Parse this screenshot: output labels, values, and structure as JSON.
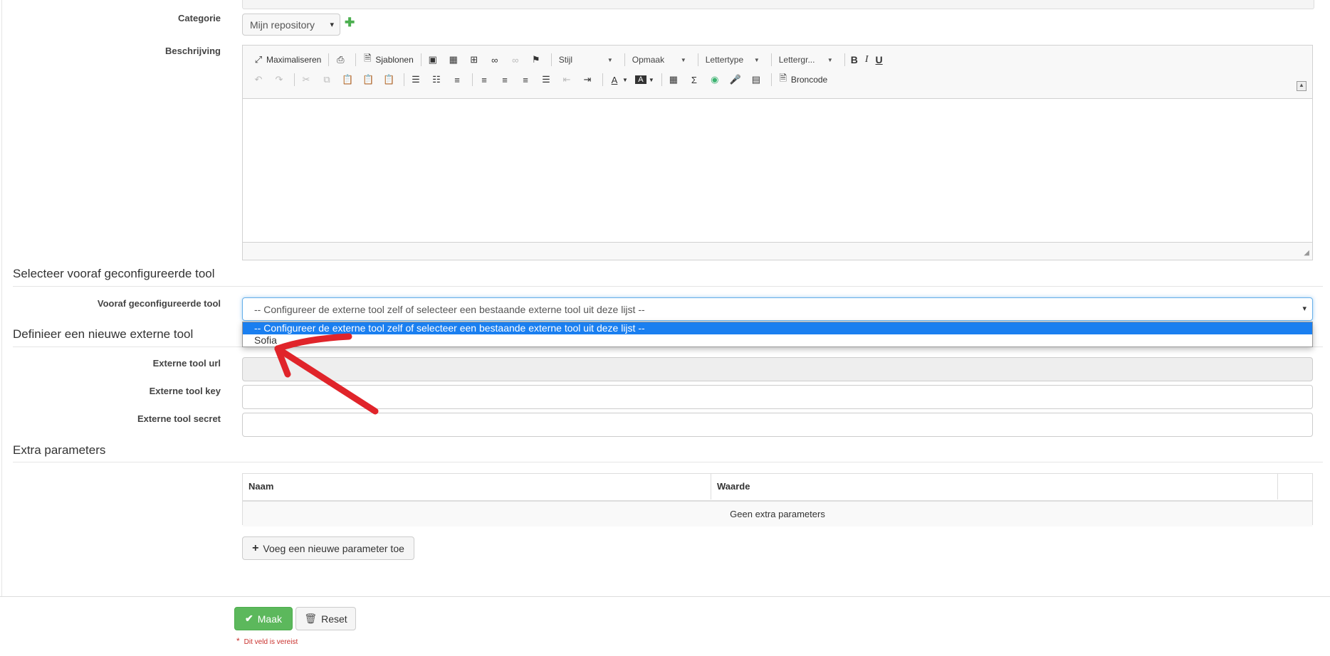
{
  "form": {
    "categorie_label": "Categorie",
    "categorie_value": "Mijn repository",
    "beschrijving_label": "Beschrijving"
  },
  "editor": {
    "row1": {
      "maximize": "Maximaliseren",
      "templates": "Sjablonen",
      "style": "Stijl",
      "format": "Opmaak",
      "font": "Lettertype",
      "size": "Lettergr...",
      "bold": "B",
      "italic": "I",
      "underline": "U"
    },
    "row2": {
      "source": "Broncode"
    }
  },
  "section_preconfigured": {
    "title": "Selecteer vooraf geconfigureerde tool",
    "label": "Vooraf geconfigureerde tool",
    "selected": "-- Configureer de externe tool zelf of selecteer een bestaande externe tool uit deze lijst --",
    "options": [
      "-- Configureer de externe tool zelf of selecteer een bestaande externe tool uit deze lijst --",
      "Sofia"
    ]
  },
  "section_new": {
    "title": "Definieer een nieuwe externe tool",
    "url_label": "Externe tool url",
    "key_label": "Externe tool key",
    "secret_label": "Externe tool secret"
  },
  "section_extra": {
    "title": "Extra parameters",
    "col_name": "Naam",
    "col_value": "Waarde",
    "empty_text": "Geen extra parameters",
    "add_button": "Voeg een nieuwe parameter toe"
  },
  "actions": {
    "submit": "Maak",
    "reset": "Reset",
    "required_note": "Dit veld is vereist",
    "required_marker": "*"
  },
  "colors": {
    "success": "#5cb85c",
    "dropdown_highlight": "#1a7ff0",
    "annotation_arrow": "#e0242a"
  }
}
